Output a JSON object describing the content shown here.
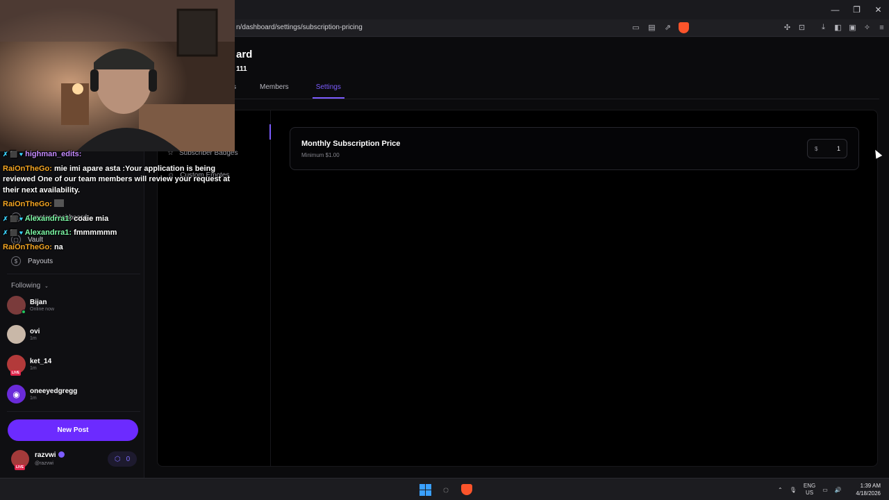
{
  "browser": {
    "url": "n/dashboard/settings/subscription-pricing",
    "window_controls": [
      "minimize",
      "maximize",
      "close"
    ]
  },
  "header": {
    "title_fragment": "ard",
    "subtitle_fragment": "111"
  },
  "tabs": [
    {
      "label": "cs",
      "active": false
    },
    {
      "label": "Members",
      "active": false
    },
    {
      "label": "Settings",
      "active": true
    }
  ],
  "sidebar": {
    "items": [
      {
        "label": "Creator Dashboard",
        "icon": "dashboard-icon"
      },
      {
        "label": "Vault",
        "icon": "vault-icon"
      },
      {
        "label": "Payouts",
        "icon": "dollar-icon"
      }
    ],
    "following_label": "Following",
    "following": [
      {
        "name": "Bijan",
        "status": "Online now",
        "live": false,
        "online": true,
        "color": "#7a3b3b"
      },
      {
        "name": "ovi",
        "status": "1m",
        "live": false,
        "online": false,
        "color": "#c9b8a8"
      },
      {
        "name": "ket_14",
        "status": "1m",
        "live": true,
        "online": false,
        "color": "#b33a3a"
      },
      {
        "name": "oneeyedgregg",
        "status": "1m",
        "live": false,
        "online": false,
        "color": "#6a2bd9"
      }
    ],
    "new_post": "New Post",
    "user": {
      "name": "razvwi",
      "handle": "@razvwi",
      "coins": "0",
      "live_badge": "LIVE"
    }
  },
  "settings": {
    "subnav": [
      {
        "label": "icing",
        "active": true
      },
      {
        "label": "Subscriber Badges",
        "active": false
      },
      {
        "label": "Custom Emotes",
        "active": false
      }
    ],
    "card": {
      "title": "Monthly Subscription Price",
      "minimum": "Minimum $1.00",
      "currency": "$",
      "value": "1"
    }
  },
  "chat": [
    {
      "user": "highman_edits:",
      "text": "",
      "user_color": "purple",
      "badges": "✗ ⬛ ♥"
    },
    {
      "user": "RaiOnTheGo:",
      "text": "mie imi apare asta :Your application is being reviewed One of our team members will review your request at their next availability.",
      "user_color": "gold",
      "badges": ""
    },
    {
      "user": "RaiOnTheGo:",
      "text": "",
      "user_color": "gold",
      "badges": ""
    },
    {
      "user": "Alexandrra1:",
      "text": "coaie mia",
      "user_color": "green",
      "badges": "✗ ⬛ ♥"
    },
    {
      "user": "Alexandrra1:",
      "text": "fmmmmmm",
      "user_color": "green",
      "badges": "✗ ⬛ ♥"
    },
    {
      "user": "RaiOnTheGo:",
      "text": "na",
      "user_color": "gold",
      "badges": ""
    }
  ],
  "taskbar": {
    "lang_top": "ENG",
    "lang_bottom": "US",
    "time": "1:39 AM",
    "date": "4/18/2026"
  },
  "colors": {
    "accent": "#7c5cff",
    "primary_button": "#6c2bff",
    "live": "#e0254b"
  }
}
